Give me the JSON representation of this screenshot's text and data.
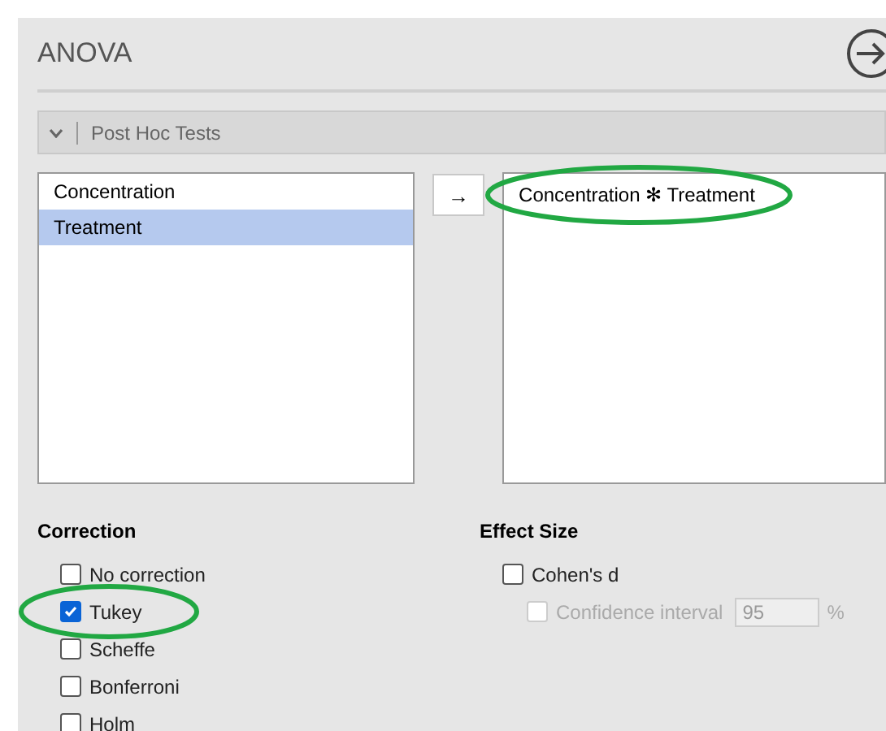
{
  "title": "ANOVA",
  "section": {
    "label": "Post Hoc Tests",
    "expanded": true
  },
  "available": [
    {
      "label": "Concentration",
      "selected": false
    },
    {
      "label": "Treatment",
      "selected": true
    }
  ],
  "move_button": "→",
  "chosen": [
    {
      "label": "Concentration ✻ Treatment",
      "circled": true
    }
  ],
  "correction": {
    "heading": "Correction",
    "options": [
      {
        "label": "No correction",
        "checked": false,
        "circled": false
      },
      {
        "label": "Tukey",
        "checked": true,
        "circled": true
      },
      {
        "label": "Scheffe",
        "checked": false,
        "circled": false
      },
      {
        "label": "Bonferroni",
        "checked": false,
        "circled": false
      },
      {
        "label": "Holm",
        "checked": false,
        "circled": false
      }
    ]
  },
  "effect_size": {
    "heading": "Effect Size",
    "cohens_d": {
      "label": "Cohen's d",
      "checked": false
    },
    "confidence": {
      "label": "Confidence interval",
      "checked": false,
      "disabled": true,
      "value": "95",
      "unit": "%"
    }
  }
}
